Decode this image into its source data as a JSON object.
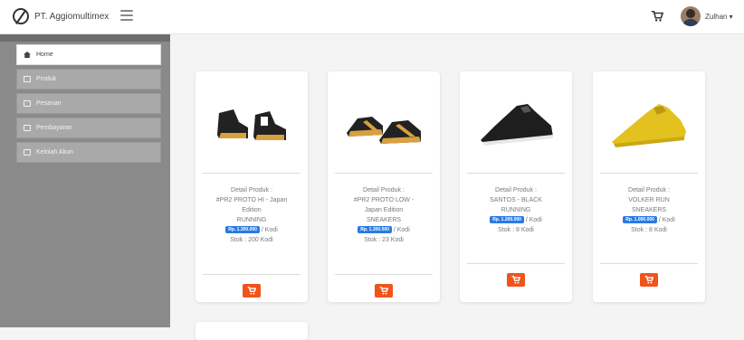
{
  "brand": {
    "name": "PT. Aggiomultimex"
  },
  "user": {
    "name": "Zulhan ▾"
  },
  "sidebar": {
    "items": [
      {
        "label": "Home",
        "active": true
      },
      {
        "label": "Produk"
      },
      {
        "label": "Pesanan"
      },
      {
        "label": "Pembayaran"
      },
      {
        "label": "Kelolah Akun"
      }
    ]
  },
  "colors": {
    "accent_orange": "#f1541a",
    "price_blue": "#2a7ae2",
    "sidebar_gray": "#8a8a8a"
  },
  "products": [
    {
      "detail_label": "Detail Produk :",
      "name_lines": [
        "#PR2 PROTO HI - Japan",
        "Edition",
        "RUNNING"
      ],
      "price": "Rp. 1.300.000",
      "unit": "/ Kodi",
      "stock": "Stok : 200 Kodi",
      "shoe_color": "#222222"
    },
    {
      "detail_label": "Detail Produk :",
      "name_lines": [
        "#PR2 PROTO LOW -",
        "Japan Edition",
        "SNEAKERS"
      ],
      "price": "Rp. 1.300.000",
      "unit": "/ Kodi",
      "stock": "Stok : 23 Kodi",
      "shoe_color": "#222222"
    },
    {
      "detail_label": "Detail Produk :",
      "name_lines": [
        "SANTOS - BLACK",
        "RUNNING"
      ],
      "price": "Rp. 1.200.000",
      "unit": "/ Kodi",
      "stock": "Stok : 8 Kodi",
      "shoe_color": "#1e1e1e"
    },
    {
      "detail_label": "Detail Produk :",
      "name_lines": [
        "VOLKER RUN",
        "SNEAKERS"
      ],
      "price": "Rp. 1.000.000",
      "unit": "/ Kodi",
      "stock": "Stok : 8 Kodi",
      "shoe_color": "#e3c21f"
    }
  ]
}
